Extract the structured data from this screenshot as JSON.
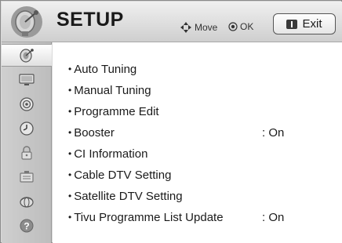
{
  "header": {
    "title": "SETUP",
    "move_label": "Move",
    "ok_label": "OK",
    "exit_label": "Exit"
  },
  "sidebar": {
    "items": [
      {
        "icon": "satellite-dish-icon",
        "active": true
      },
      {
        "icon": "tv-picture-icon",
        "active": false
      },
      {
        "icon": "audio-speaker-icon",
        "active": false
      },
      {
        "icon": "clock-icon",
        "active": false
      },
      {
        "icon": "lock-icon",
        "active": false
      },
      {
        "icon": "options-icon",
        "active": false
      },
      {
        "icon": "globe-network-icon",
        "active": false
      },
      {
        "icon": "help-icon",
        "active": false
      }
    ]
  },
  "menu": {
    "items": [
      {
        "label": "Auto Tuning",
        "value": ""
      },
      {
        "label": "Manual Tuning",
        "value": ""
      },
      {
        "label": "Programme Edit",
        "value": ""
      },
      {
        "label": "Booster",
        "value": ": On"
      },
      {
        "label": "CI Information",
        "value": ""
      },
      {
        "label": "Cable DTV Setting",
        "value": ""
      },
      {
        "label": "Satellite DTV Setting",
        "value": ""
      },
      {
        "label": "Tivu Programme List Update",
        "value": ": On"
      }
    ]
  },
  "colors": {
    "header_bg": "#e0e0e0",
    "sidebar_bg": "#c8c8c8",
    "content_bg": "#ffffff",
    "text": "#1a1a1a"
  }
}
